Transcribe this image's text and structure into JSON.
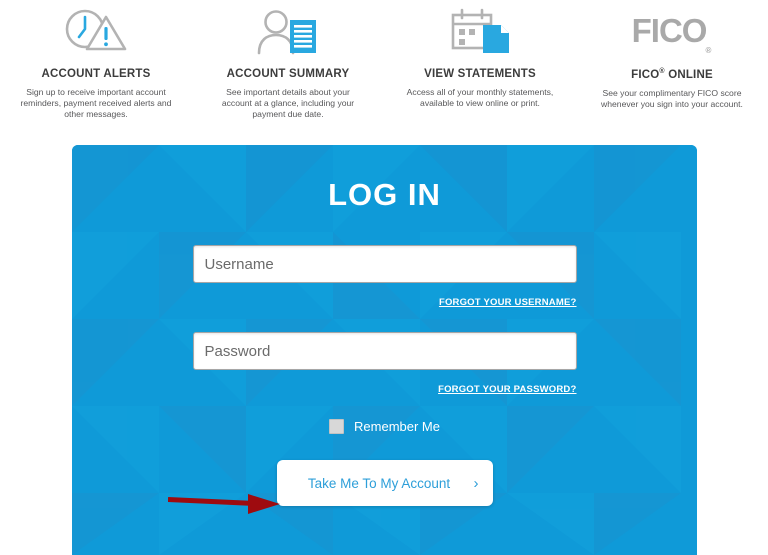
{
  "features": [
    {
      "id": "account-alerts",
      "icon": "clock-alert-icon",
      "title": "ACCOUNT ALERTS",
      "description": "Sign up to receive important account reminders, payment received alerts and other messages."
    },
    {
      "id": "account-summary",
      "icon": "user-document-icon",
      "title": "ACCOUNT SUMMARY",
      "description": "See important details about your account at a glance, including your payment due date."
    },
    {
      "id": "view-statements",
      "icon": "calendar-document-icon",
      "title": "VIEW STATEMENTS",
      "description": "Access all of your monthly statements, available to view online or print."
    },
    {
      "id": "fico-online",
      "icon": "fico-logo-icon",
      "logo_text": "FICO",
      "logo_tm": "®",
      "title_pre": "FICO",
      "title_reg": "®",
      "title_post": "ONLINE",
      "description": "See your complimentary FICO score whenever you sign into your account."
    }
  ],
  "login": {
    "title": "LOG IN",
    "username": {
      "value": "",
      "placeholder": "Username",
      "forgot_label": "FORGOT YOUR USERNAME?"
    },
    "password": {
      "value": "",
      "placeholder": "Password",
      "forgot_label": "FORGOT YOUR PASSWORD?"
    },
    "remember_me": {
      "label": "Remember Me",
      "checked": false
    },
    "submit": {
      "label": "Take Me To My Account",
      "chevron": "›"
    }
  },
  "colors": {
    "panel_blue": "#0f9ad8",
    "panel_blue_dark": "#1590cd",
    "panel_blue_light": "#12a2dd",
    "cta_text": "#2e9fd9",
    "icon_blue": "#29a8e0",
    "icon_gray": "#b3b3b3",
    "arrow_red": "#9e0b0f",
    "heading_gray": "#3c3c3c",
    "body_gray": "#58585a",
    "fico_logo_gray": "#a9a9a9"
  },
  "annotation": {
    "arrow": "red-pointer-arrow",
    "points_to": "Take Me To My Account"
  }
}
